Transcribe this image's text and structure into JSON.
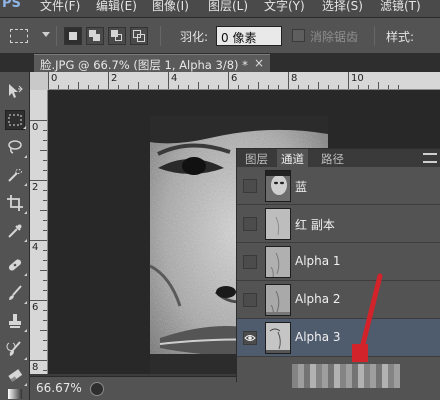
{
  "app": {
    "logo": "PS"
  },
  "menu": {
    "items": [
      "文件(F)",
      "编辑(E)",
      "图像(I)",
      "图层(L)",
      "文字(Y)",
      "选择(S)",
      "滤镜(T)"
    ]
  },
  "options_bar": {
    "feather_label": "羽化:",
    "feather_value": "0 像素",
    "antialias_label": "消除锯齿",
    "style_label": "样式:"
  },
  "document": {
    "tab_title": "脸.JPG @ 66.7% (图层 1, Alpha 3/8) *",
    "close_symbol": "×"
  },
  "rulers": {
    "top_labels": [
      "0",
      "2",
      "4",
      "6",
      "8",
      "10"
    ],
    "left_labels": [
      "0",
      "2",
      "4",
      "6",
      "8"
    ]
  },
  "status": {
    "zoom": "66.67%"
  },
  "panel": {
    "tabs": [
      "图层",
      "通道",
      "路径"
    ],
    "active_tab": "通道",
    "channels": [
      {
        "name": "蓝",
        "visible": false,
        "selected": false
      },
      {
        "name": "红 副本",
        "visible": false,
        "selected": false
      },
      {
        "name": "Alpha 1",
        "visible": false,
        "selected": false
      },
      {
        "name": "Alpha 2",
        "visible": false,
        "selected": false
      },
      {
        "name": "Alpha 3",
        "visible": true,
        "selected": true
      }
    ]
  },
  "colors": {
    "selection_highlight": "#4f5c6e",
    "annotation_arrow": "#d3232a",
    "canvas_bg": "#282828",
    "panel_bg": "#535353"
  },
  "icons": {
    "toolbar": [
      "move-icon",
      "marquee-icon",
      "lasso-icon",
      "quick-select-icon",
      "crop-icon",
      "eyedropper-icon",
      "healing-icon",
      "brush-icon",
      "stamp-icon",
      "history-brush-icon",
      "eraser-icon",
      "gradient-icon"
    ],
    "visibility": "eye-icon"
  }
}
